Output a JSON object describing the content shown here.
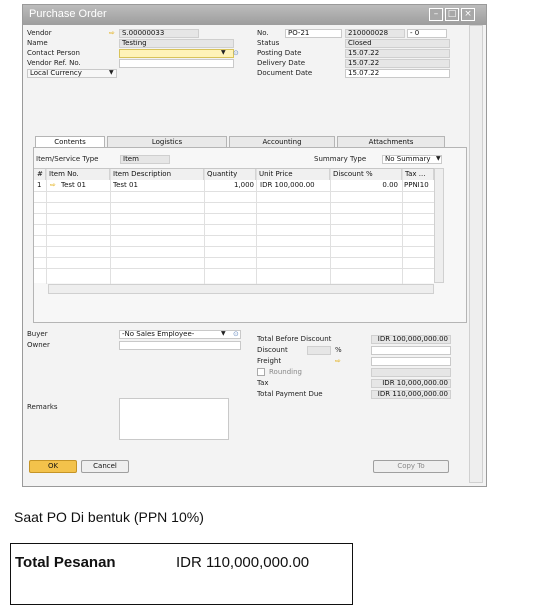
{
  "window": {
    "title": "Purchase Order"
  },
  "header": {
    "vendor": {
      "label": "Vendor",
      "value": "S.00000033"
    },
    "name": {
      "label": "Name",
      "value": "Testing"
    },
    "contact_person": {
      "label": "Contact Person",
      "value": ""
    },
    "vendor_ref": {
      "label": "Vendor Ref. No.",
      "value": ""
    },
    "currency": {
      "label": "Local Currency"
    },
    "no": {
      "label": "No.",
      "series": "PO-21",
      "number": "210000028",
      "suffix": "- 0"
    },
    "status": {
      "label": "Status",
      "value": "Closed"
    },
    "posting_date": {
      "label": "Posting Date",
      "value": "15.07.22"
    },
    "delivery_date": {
      "label": "Delivery Date",
      "value": "15.07.22"
    },
    "document_date": {
      "label": "Document Date",
      "value": "15.07.22"
    }
  },
  "tabs": [
    "Contents",
    "Logistics",
    "Accounting",
    "Attachments"
  ],
  "contents": {
    "item_service_type_label": "Item/Service Type",
    "item_service_type_value": "Item",
    "summary_type_label": "Summary Type",
    "summary_type_value": "No Summary",
    "columns": [
      "#",
      "Item No.",
      "Item Description",
      "Quantity",
      "Unit Price",
      "Discount %",
      "Tax ..."
    ],
    "rows": [
      {
        "num": "1",
        "item_no": "Test 01",
        "desc": "Test 01",
        "qty": "1,000",
        "price": "IDR 100,000.00",
        "discount": "0.00",
        "tax": "PPNI10"
      }
    ]
  },
  "footer": {
    "buyer": {
      "label": "Buyer",
      "value": "-No Sales Employee-"
    },
    "owner": {
      "label": "Owner"
    },
    "remarks": {
      "label": "Remarks"
    },
    "total_before_discount": {
      "label": "Total Before Discount",
      "value": "IDR 100,000,000.00"
    },
    "discount": {
      "label": "Discount",
      "pct": "%"
    },
    "freight": {
      "label": "Freight"
    },
    "rounding": {
      "label": "Rounding"
    },
    "tax": {
      "label": "Tax",
      "value": "IDR 10,000,000.00"
    },
    "total_payment_due": {
      "label": "Total Payment Due",
      "value": "IDR 110,000,000.00"
    }
  },
  "buttons": {
    "ok": "OK",
    "cancel": "Cancel",
    "copy_to": "Copy To"
  },
  "caption": "Saat PO Di bentuk (PPN 10%)",
  "total_pesanan": {
    "label": "Total Pesanan",
    "value": "IDR 110,000,000.00"
  }
}
